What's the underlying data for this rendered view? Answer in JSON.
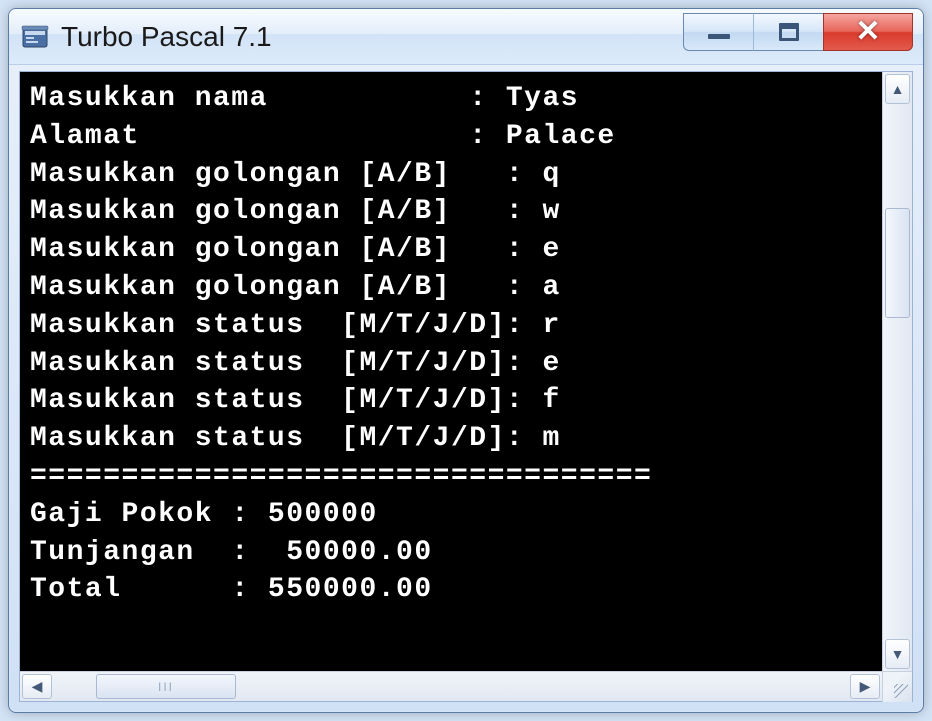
{
  "window": {
    "title": "Turbo Pascal 7.1"
  },
  "console": {
    "lines": [
      "Masukkan nama           : Tyas",
      "Alamat                  : Palace",
      "Masukkan golongan [A/B]   : q",
      "Masukkan golongan [A/B]   : w",
      "Masukkan golongan [A/B]   : e",
      "Masukkan golongan [A/B]   : a",
      "Masukkan status  [M/T/J/D]: r",
      "Masukkan status  [M/T/J/D]: e",
      "Masukkan status  [M/T/J/D]: f",
      "Masukkan status  [M/T/J/D]: m",
      "==================================",
      "Gaji Pokok : 500000",
      "Tunjangan  :  50000.00",
      "Total      : 550000.00"
    ]
  },
  "scroll": {
    "hthumb_grip": "III"
  }
}
